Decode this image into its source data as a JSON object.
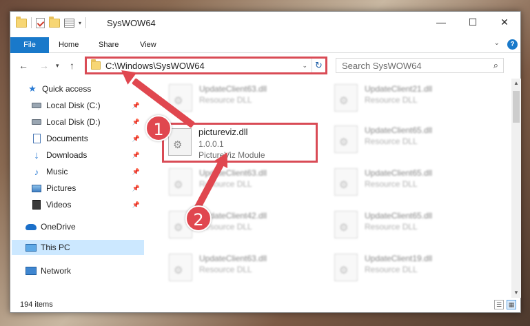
{
  "window": {
    "title": "SysWOW64",
    "controls": {
      "minimize": "—",
      "maximize": "☐",
      "close": "✕"
    }
  },
  "ribbon": {
    "tabs": [
      {
        "label": "File"
      },
      {
        "label": "Home"
      },
      {
        "label": "Share"
      },
      {
        "label": "View"
      }
    ],
    "help": "?"
  },
  "address": {
    "path": "C:\\Windows\\SysWOW64",
    "search_placeholder": "Search SysWOW64"
  },
  "navpane": {
    "items": [
      {
        "label": "Quick access",
        "icon": "star-icon"
      },
      {
        "label": "Local Disk (C:)",
        "icon": "drive-icon",
        "pinned": true
      },
      {
        "label": "Local Disk (D:)",
        "icon": "drive-icon",
        "pinned": true
      },
      {
        "label": "Documents",
        "icon": "documents-icon",
        "pinned": true
      },
      {
        "label": "Downloads",
        "icon": "downloads-icon",
        "pinned": true
      },
      {
        "label": "Music",
        "icon": "music-icon",
        "pinned": true
      },
      {
        "label": "Pictures",
        "icon": "pictures-icon",
        "pinned": true
      },
      {
        "label": "Videos",
        "icon": "videos-icon",
        "pinned": true
      },
      {
        "label": "OneDrive",
        "icon": "onedrive-icon"
      },
      {
        "label": "This PC",
        "icon": "this-pc-icon",
        "selected": true
      },
      {
        "label": "Network",
        "icon": "network-icon"
      }
    ]
  },
  "files": {
    "left": [
      {
        "name": "UpdateClient63.dll",
        "desc": "Resource DLL"
      },
      {
        "name": "UpdateClient63.dll",
        "desc": "Resource DLL"
      },
      {
        "name": "UpdateClient42.dll",
        "desc": "Resource DLL"
      },
      {
        "name": "UpdateClient63.dll",
        "desc": "Resource DLL"
      }
    ],
    "right": [
      {
        "name": "UpdateClient21.dll",
        "desc": "Resource DLL"
      },
      {
        "name": "UpdateClient65.dll",
        "desc": "Resource DLL"
      },
      {
        "name": "UpdateClient65.dll",
        "desc": "Resource DLL"
      },
      {
        "name": "UpdateClient65.dll",
        "desc": "Resource DLL"
      },
      {
        "name": "UpdateClient19.dll",
        "desc": "Resource DLL"
      }
    ],
    "highlighted": {
      "name": "pictureviz.dll",
      "version": "1.0.0.1",
      "desc": "PictureViz Module"
    }
  },
  "status": {
    "item_count": "194 items"
  },
  "annotations": {
    "step1": "1",
    "step2": "2"
  },
  "colors": {
    "accent": "#1979ca",
    "annotation": "#e0474f",
    "selected_bg": "#cce8ff"
  }
}
